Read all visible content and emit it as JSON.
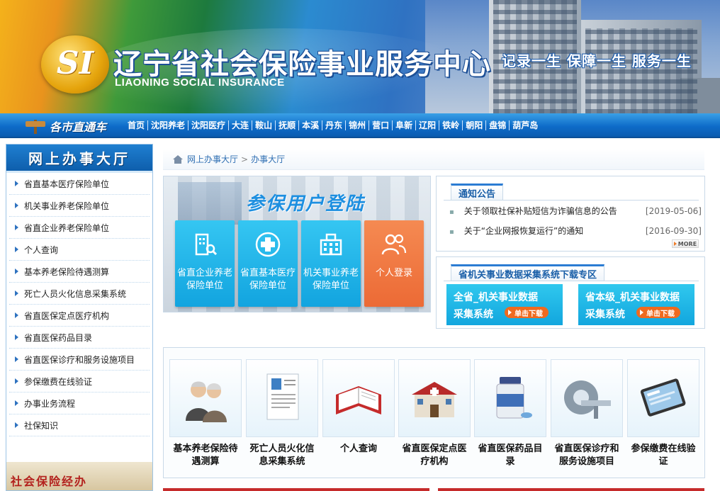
{
  "header": {
    "logo_text": "SI",
    "title_cn": "辽宁省社会保险事业服务中心",
    "title_en": "LIAONING SOCIAL INSURANCE",
    "slogan": "记录一生 保障一生 服务一生"
  },
  "citynav": {
    "label": "各市直通车",
    "links": [
      "首页",
      "沈阳养老",
      "沈阳医疗",
      "大连",
      "鞍山",
      "抚顺",
      "本溪",
      "丹东",
      "锦州",
      "营口",
      "阜新",
      "辽阳",
      "铁岭",
      "朝阳",
      "盘锦",
      "葫芦岛"
    ]
  },
  "sidebar": {
    "title": "网上办事大厅",
    "items": [
      "省直基本医疗保险单位",
      "机关事业养老保险单位",
      "省直企业养老保险单位",
      "个人查询",
      "基本养老保险待遇测算",
      "死亡人员火化信息采集系统",
      "省直医保定点医疗机构",
      "省直医保药品目录",
      "省直医保诊疗和服务设施项目",
      "参保缴费在线验证",
      "办事业务流程",
      "社保知识"
    ],
    "footer_text": "社会保险经办"
  },
  "breadcrumb": {
    "items": [
      "网上办事大厅",
      "办事大厅"
    ],
    "separator": ">"
  },
  "login": {
    "title": "参保用户登陆",
    "tiles": [
      {
        "label": "省直企业养老保险单位",
        "icon": "building-search-icon",
        "color": "#1fb3e8"
      },
      {
        "label": "省直基本医疗保险单位",
        "icon": "medical-cross-icon",
        "color": "#1fb3e8"
      },
      {
        "label": "机关事业养老保险单位",
        "icon": "office-building-icon",
        "color": "#1fb3e8"
      },
      {
        "label": "个人登录",
        "icon": "user-group-icon",
        "color": "#ef7640"
      }
    ]
  },
  "notice": {
    "title": "通知公告",
    "items": [
      {
        "text": "关于领取社保补贴短信为诈骗信息的公告",
        "date": "[2019-05-06]"
      },
      {
        "text": "关于“企业网报恢复运行”的通知",
        "date": "[2016-09-30]"
      }
    ],
    "more_label": "MORE"
  },
  "download": {
    "title": "省机关事业数据采集系统下载专区",
    "buttons": [
      {
        "line1": "全省_机关事业数据",
        "line2": "采集系统",
        "action": "单击下载"
      },
      {
        "line1": "省本级_机关事业数据",
        "line2": "采集系统",
        "action": "单击下载"
      }
    ]
  },
  "shortcuts": [
    {
      "label": "基本养老保险待遇测算",
      "icon": "elderly-couple-icon"
    },
    {
      "label": "死亡人员火化信息采集系统",
      "icon": "document-form-icon"
    },
    {
      "label": "个人查询",
      "icon": "open-book-icon"
    },
    {
      "label": "省直医保定点医疗机构",
      "icon": "hospital-icon"
    },
    {
      "label": "省直医保药品目录",
      "icon": "medicine-bottle-icon"
    },
    {
      "label": "省直医保诊疗和服务设施项目",
      "icon": "ct-scanner-icon"
    },
    {
      "label": "参保缴费在线验证",
      "icon": "tablet-device-icon"
    }
  ],
  "colors": {
    "primary_blue": "#0e6cc9",
    "tile_blue": "#1fb3e8",
    "tile_orange": "#ef7640",
    "download_btn": "#ef6a1f"
  }
}
